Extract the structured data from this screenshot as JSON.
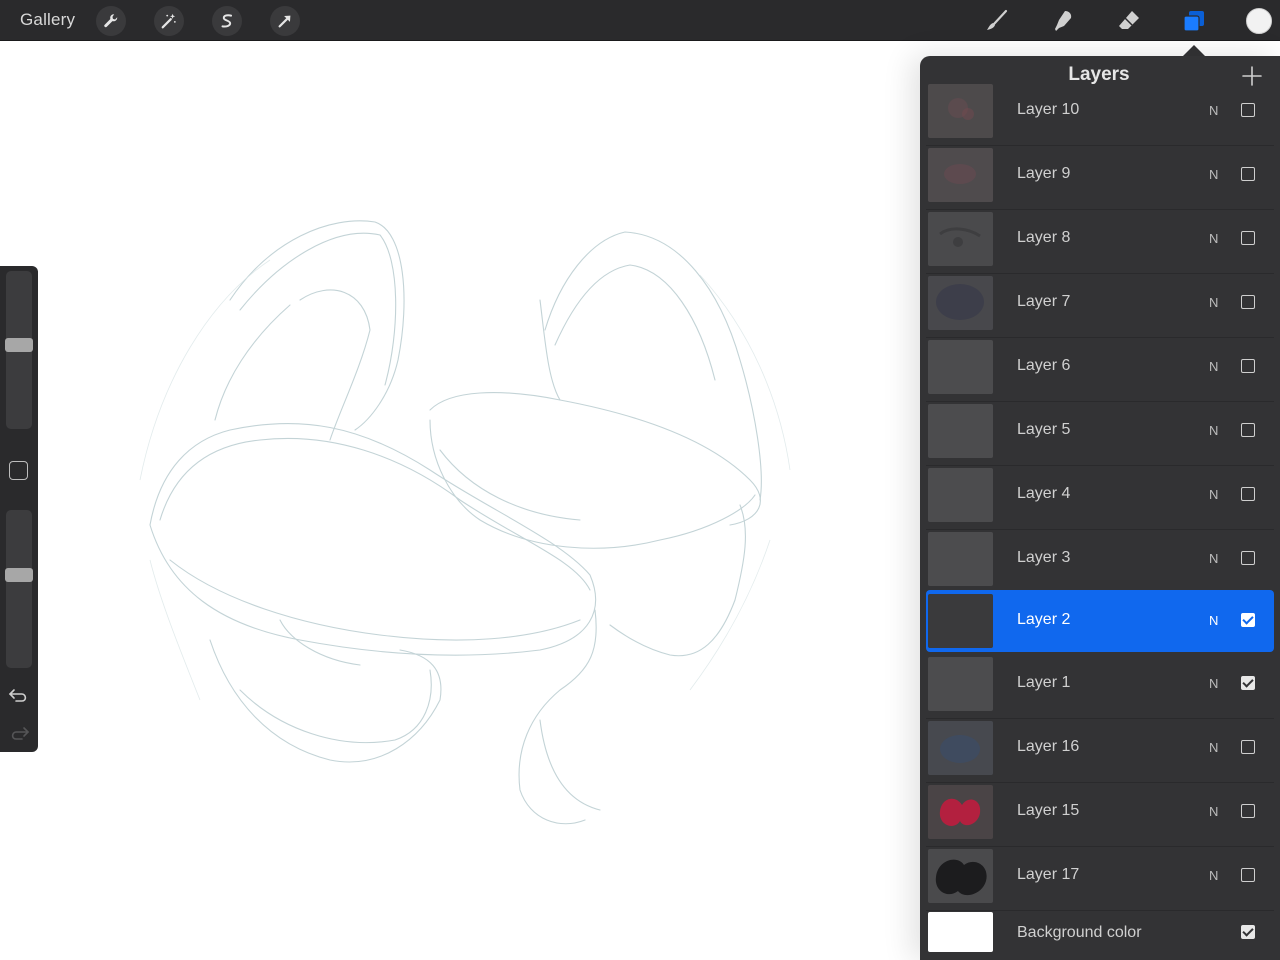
{
  "topbar": {
    "gallery_label": "Gallery",
    "left_tools": [
      "wrench-icon",
      "magic-wand-icon",
      "selection-s-icon",
      "transform-arrow-icon"
    ],
    "right_tools": [
      "brush-icon",
      "smudge-icon",
      "eraser-icon",
      "layers-icon"
    ],
    "active_tool": "layers-icon",
    "current_color": "#f2f2f2",
    "accent": "#1068ee"
  },
  "sidebar": {
    "brush_size_level": 0.6,
    "opacity_level": 0.33
  },
  "layers_panel": {
    "title": "Layers",
    "layers": [
      {
        "name": "Layer 10",
        "blend": "N",
        "visible": false,
        "selected": false
      },
      {
        "name": "Layer 9",
        "blend": "N",
        "visible": false,
        "selected": false
      },
      {
        "name": "Layer 8",
        "blend": "N",
        "visible": false,
        "selected": false
      },
      {
        "name": "Layer 7",
        "blend": "N",
        "visible": false,
        "selected": false
      },
      {
        "name": "Layer 6",
        "blend": "N",
        "visible": false,
        "selected": false
      },
      {
        "name": "Layer 5",
        "blend": "N",
        "visible": false,
        "selected": false
      },
      {
        "name": "Layer 4",
        "blend": "N",
        "visible": false,
        "selected": false
      },
      {
        "name": "Layer 3",
        "blend": "N",
        "visible": false,
        "selected": false
      },
      {
        "name": "Layer 2",
        "blend": "N",
        "visible": true,
        "selected": true
      },
      {
        "name": "Layer 1",
        "blend": "N",
        "visible": true,
        "selected": false
      },
      {
        "name": "Layer 16",
        "blend": "N",
        "visible": false,
        "selected": false
      },
      {
        "name": "Layer 15",
        "blend": "N",
        "visible": false,
        "selected": false
      },
      {
        "name": "Layer 17",
        "blend": "N",
        "visible": false,
        "selected": false
      }
    ],
    "background": {
      "name": "Background color",
      "visible": true
    }
  }
}
